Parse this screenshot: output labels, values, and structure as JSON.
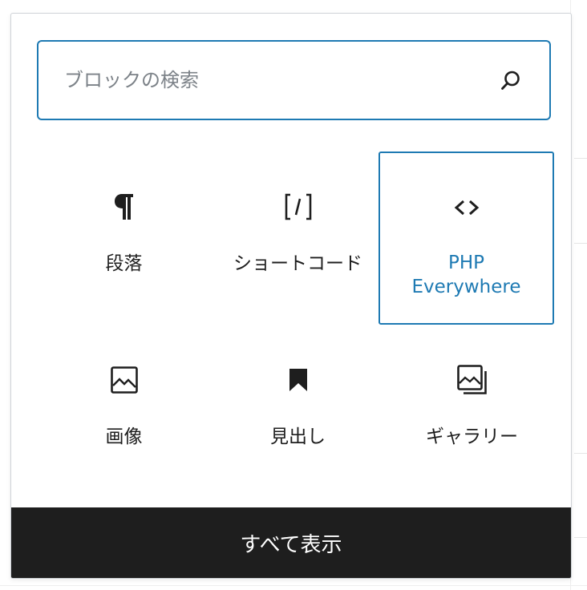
{
  "search": {
    "placeholder": "ブロックの検索",
    "value": ""
  },
  "blocks": [
    {
      "label": "段落",
      "icon": "paragraph-icon",
      "selected": false
    },
    {
      "label": "ショートコード",
      "icon": "shortcode-icon",
      "selected": false
    },
    {
      "label": "PHP\nEverywhere",
      "icon": "code-icon",
      "selected": true
    },
    {
      "label": "画像",
      "icon": "image-icon",
      "selected": false
    },
    {
      "label": "見出し",
      "icon": "bookmark-icon",
      "selected": false
    },
    {
      "label": "ギャラリー",
      "icon": "gallery-icon",
      "selected": false
    }
  ],
  "footer": {
    "show_all_label": "すべて表示"
  },
  "colors": {
    "accent": "#1e7ab3",
    "text": "#1e1e1e",
    "footer_bg": "#1e1e1e"
  }
}
